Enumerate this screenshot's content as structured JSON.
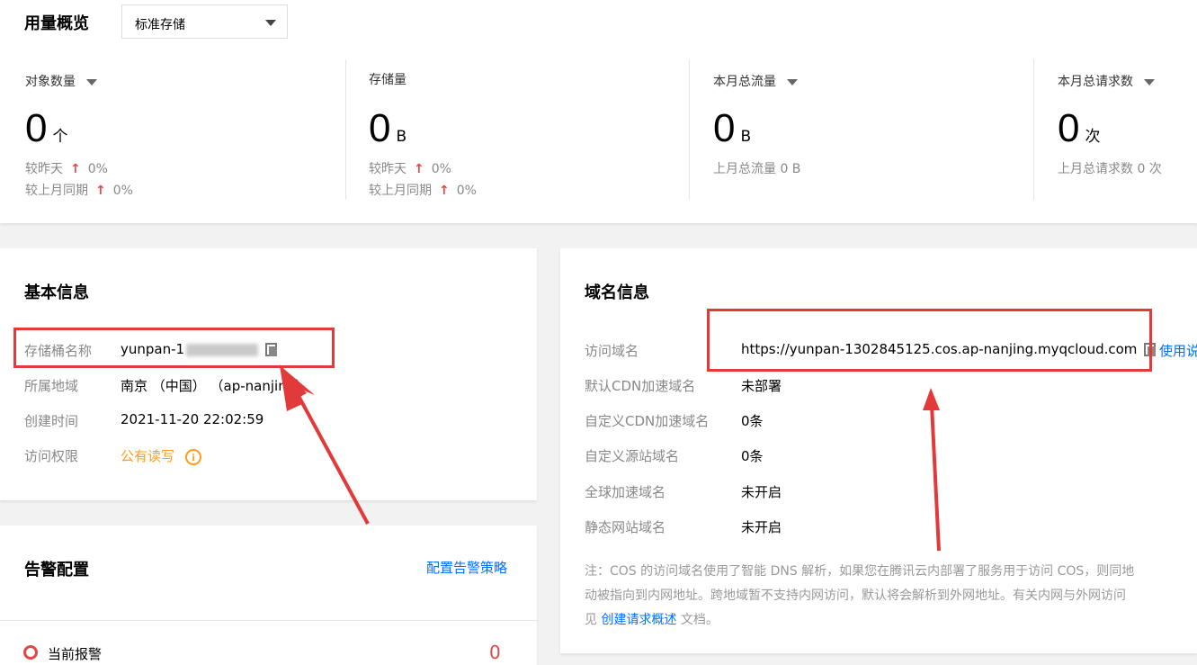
{
  "usage": {
    "title": "用量概览",
    "storage_type_select": "标准存储",
    "stats": [
      {
        "label": "对象数量",
        "value": "0",
        "unit": "个",
        "sub1_label": "较昨天",
        "sub1_value": "0%",
        "sub2_label": "较上月同期",
        "sub2_value": "0%"
      },
      {
        "label": "存储量",
        "value": "0",
        "unit": "B",
        "sub1_label": "较昨天",
        "sub1_value": "0%",
        "sub2_label": "较上月同期",
        "sub2_value": "0%"
      },
      {
        "label": "本月总流量",
        "value": "0",
        "unit": "B",
        "sub1_text": "上月总流量 0 B"
      },
      {
        "label": "本月总请求数",
        "value": "0",
        "unit": "次",
        "sub1_text": "上月总请求数 0 次"
      }
    ]
  },
  "basic_info": {
    "title": "基本信息",
    "rows": [
      {
        "label": "存储桶名称",
        "value": "yunpan-1"
      },
      {
        "label": "所属地域",
        "value": "南京 （中国） （ap-nanjing）"
      },
      {
        "label": "创建时间",
        "value": "2021-11-20 22:02:59"
      },
      {
        "label": "访问权限",
        "value": "公有读写"
      }
    ]
  },
  "alarm": {
    "title": "告警配置",
    "config_link": "配置告警策略",
    "current_label": "当前报警",
    "current_count": "0"
  },
  "domain_info": {
    "title": "域名信息",
    "rows": [
      {
        "label": "访问域名",
        "value": "https://yunpan-1302845125.cos.ap-nanjing.myqcloud.com",
        "action": "使用说"
      },
      {
        "label": "默认CDN加速域名",
        "value": "未部署"
      },
      {
        "label": "自定义CDN加速域名",
        "value": "0条"
      },
      {
        "label": "自定义源站域名",
        "value": "0条"
      },
      {
        "label": "全球加速域名",
        "value": "未开启"
      },
      {
        "label": "静态网站域名",
        "value": "未开启"
      }
    ],
    "note_line1": "注：COS 的访问域名使用了智能 DNS 解析，如果您在腾讯云内部署了服务用于访问 COS，则同地",
    "note_line2": "动被指向到内网地址。跨地域暂不支持内网访问，默认将会解析到外网地址。有关内网与外网访问",
    "note_line3_prefix": "见 ",
    "note_link": "创建请求概述",
    "note_line3_suffix": " 文档。"
  },
  "colors": {
    "accent_link": "#006eff",
    "warning_orange": "#ff9c19",
    "up_red": "#e54545",
    "annotation_red": "#e23a3a"
  }
}
